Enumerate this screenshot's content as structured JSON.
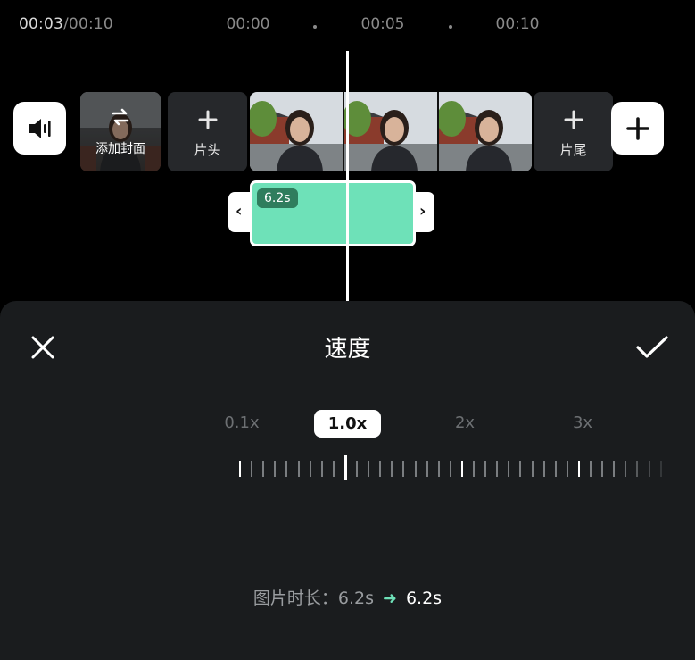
{
  "timeline": {
    "current_time": "00:03",
    "total_time": "/00:10",
    "ruler_labels": [
      "00:00",
      "00:05",
      "00:10"
    ]
  },
  "track": {
    "cover_label": "添加封面",
    "intro_label": "片头",
    "outro_label": "片尾",
    "clip_duration": "6.2s"
  },
  "speed_panel": {
    "title": "速度",
    "options": [
      "0.1x",
      "2x",
      "3x"
    ],
    "selected": "1.0x",
    "duration_prefix": "图片时长：",
    "duration_from": "6.2s",
    "duration_to": "6.2s"
  },
  "colors": {
    "accent": "#6ee1b8",
    "sheet_bg": "#1a1c1e",
    "tile_bg": "#26282b"
  }
}
